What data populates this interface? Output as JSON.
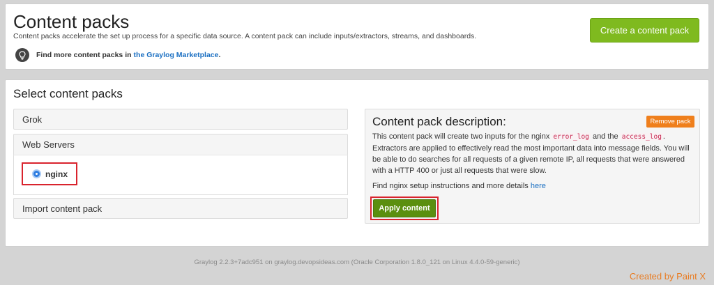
{
  "header": {
    "title": "Content packs",
    "description": "Content packs accelerate the set up process for a specific data source. A content pack can include inputs/extractors, streams, and dashboards.",
    "hint_text": "Find more content packs in",
    "hint_link": "the Graylog Marketplace",
    "hint_suffix": ".",
    "create_button": "Create a content pack",
    "hint_icon": "lightbulb-icon"
  },
  "select": {
    "title": "Select content packs",
    "categories": [
      {
        "label": "Grok"
      },
      {
        "label": "Web Servers"
      },
      {
        "label": "Import content pack"
      }
    ],
    "packs": [
      {
        "label": "nginx",
        "selected": true
      }
    ]
  },
  "description": {
    "title": "Content pack description:",
    "remove_button": "Remove pack",
    "text_part1": "This content pack will create two inputs for the nginx ",
    "code1": "error_log",
    "text_part2": " and the ",
    "code2": "access_log",
    "text_part3": ". Extractors are applied to effectively read the most important data into message fields. You will be able to do searches for all requests of a given remote IP, all requests that were answered with a HTTP 400 or just all requests that were slow.",
    "setup_text": "Find nginx setup instructions and more details ",
    "setup_link": "here",
    "apply_button": "Apply content"
  },
  "footer": {
    "text": "Graylog 2.2.3+7adc951 on graylog.devopsideas.com (Oracle Corporation 1.8.0_121 on Linux 4.4.0-59-generic)"
  },
  "watermark": "Created by Paint X",
  "colors": {
    "create_button": "#7fba1f",
    "apply_button": "#5b8f0f",
    "remove_button": "#ef7f1c",
    "link": "#1a6fc2",
    "highlight_box": "#d9232d"
  }
}
